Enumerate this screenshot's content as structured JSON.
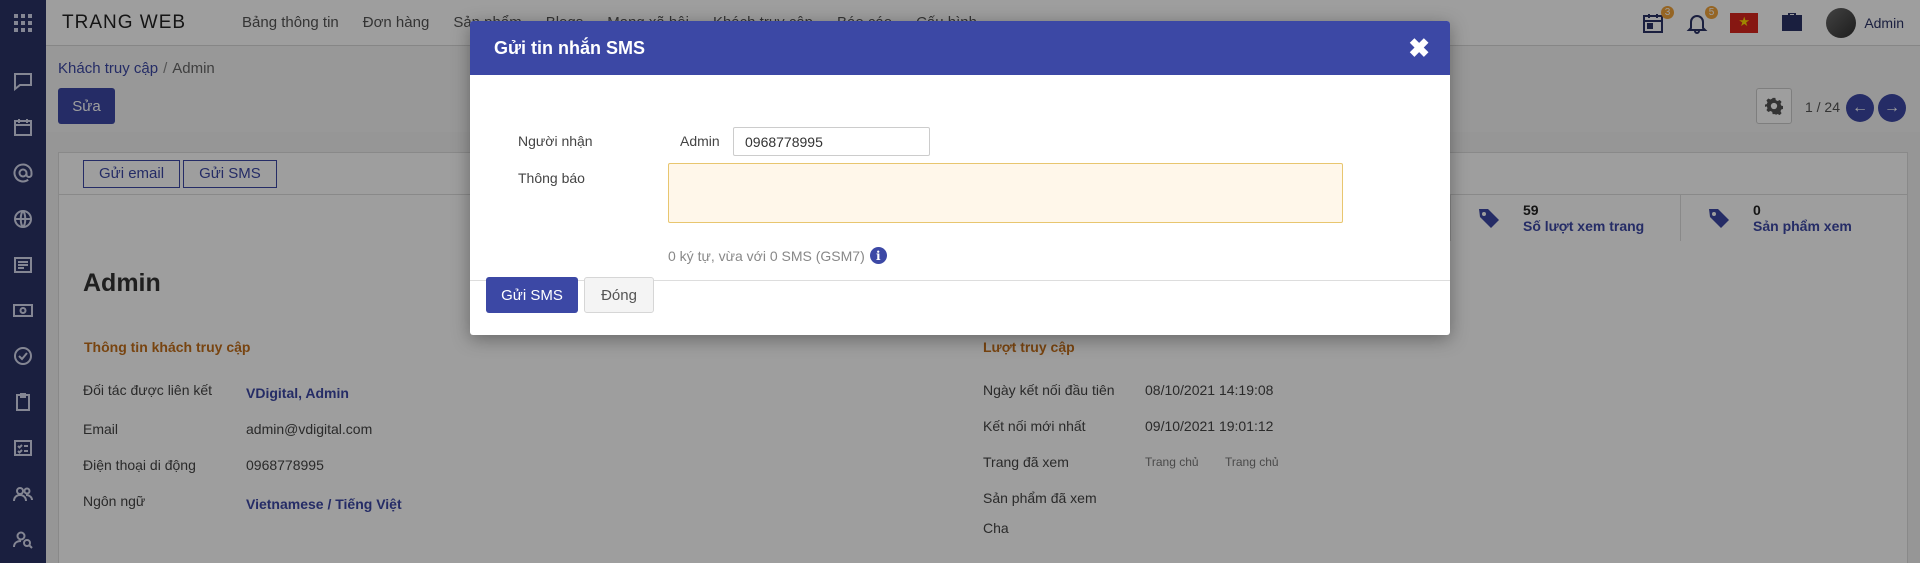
{
  "app": {
    "brand": "TRANG WEB",
    "menu": [
      "Bảng thông tin",
      "Đơn hàng",
      "Sản phẩm",
      "Blogs",
      "Mạng xã hội",
      "Khách truy cập",
      "Báo cáo",
      "Cấu hình"
    ],
    "activity_count": "3",
    "notification_count": "5",
    "user_name": "Admin"
  },
  "sidebar": {
    "icons": [
      "apps-icon",
      "chat-icon",
      "calendar-icon",
      "at-icon",
      "globe-icon",
      "news-icon",
      "money-icon",
      "check-icon",
      "clipboard-icon",
      "checklist-icon",
      "users-icon",
      "user-search-icon"
    ]
  },
  "breadcrumb": {
    "parent": "Khách truy cập",
    "current": "Admin"
  },
  "control": {
    "edit_label": "Sửa",
    "pager": "1 / 24"
  },
  "form": {
    "send_email_label": "Gửi email",
    "send_sms_label": "Gửi SMS",
    "stats": [
      {
        "value": "59",
        "label": "Số lượt xem trang"
      },
      {
        "value": "0",
        "label": "Sản phẩm xem"
      }
    ],
    "record_name": "Admin",
    "left_section_title": "Thông tin khách truy cập",
    "left_rows": [
      {
        "label": "Đối tác được liên kết",
        "value": "VDigital, Admin"
      },
      {
        "label": "Email",
        "value": "admin@vdigital.com"
      },
      {
        "label": "Điện thoại di động",
        "value": "0968778995"
      },
      {
        "label": "Ngôn ngữ",
        "value": "Vietnamese / Tiếng Việt"
      }
    ],
    "right_section_title": "Lượt truy cập",
    "right_rows": [
      {
        "label": "Ngày kết nối đầu tiên",
        "value": "08/10/2021 14:19:08"
      },
      {
        "label": "Kết nối mới nhất",
        "value": "09/10/2021 19:01:12"
      },
      {
        "label": "Trang đã xem",
        "tags": [
          "Trang chủ",
          "Trang chủ"
        ]
      },
      {
        "label": "Sản phẩm đã xem"
      },
      {
        "label": "Cha"
      }
    ]
  },
  "modal": {
    "title": "Gửi tin nhắn SMS",
    "recipient_label": "Người nhận",
    "recipient_name": "Admin",
    "recipient_number": "0968778995",
    "message_label": "Thông báo",
    "message_value": "",
    "hint": "0 ký tự, vừa với 0 SMS (GSM7)",
    "send_label": "Gửi SMS",
    "close_label": "Đóng"
  }
}
